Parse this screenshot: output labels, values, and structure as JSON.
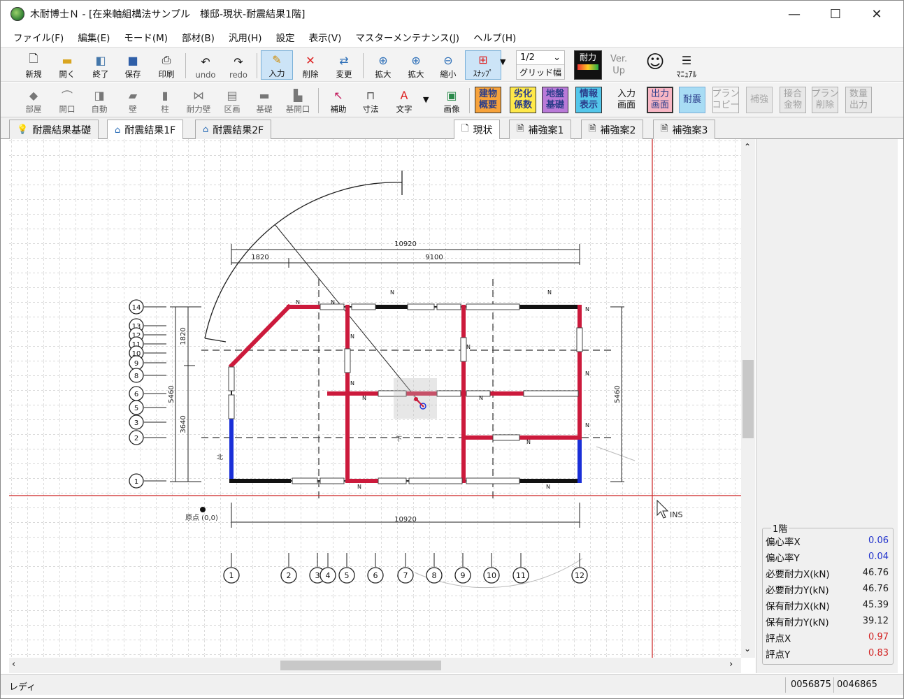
{
  "window": {
    "title": "木耐博士Ｎ - [在来軸組構法サンプル　様邸-現状-耐震結果1階]",
    "minimize": "—",
    "maximize": "☐",
    "close": "✕"
  },
  "menu": [
    "ファイル(F)",
    "編集(E)",
    "モード(M)",
    "部材(B)",
    "汎用(H)",
    "設定",
    "表示(V)",
    "マスターメンテナンス(J)",
    "ヘルプ(H)"
  ],
  "toolbar1": {
    "new": "新規",
    "open": "開く",
    "exit": "終了",
    "save": "保存",
    "print": "印刷",
    "undo": "undo",
    "redo": "redo",
    "input": "入力",
    "delete": "削除",
    "change": "変更",
    "zoom_in": "拡大",
    "zoom_in2": "拡大",
    "zoom_out": "縮小",
    "snap": "ｽﾅｯﾌﾟ",
    "grid_value": "1/2",
    "grid_label": "グリッド幅",
    "strength": "耐力",
    "ver_up_1": "Ver.",
    "ver_up_2": "Up",
    "manual": "ﾏﾆｭｱﾙ"
  },
  "toolbar2": {
    "room": "部屋",
    "opening": "開口",
    "auto": "自動",
    "wall": "壁",
    "pillar": "柱",
    "bearing_wall": "耐力壁",
    "zone": "区画",
    "foundation": "基礎",
    "foundation_opening": "基開口",
    "auxiliary": "補助",
    "dimension": "寸法",
    "text": "文字",
    "image": "画像",
    "building_overview": "建物\n概要",
    "deterioration": "劣化\n係数",
    "ground": "地盤\n基礎",
    "info": "情報\n表示",
    "input_screen": "入力\n画面",
    "output_screen": "出力\n画面",
    "seismic": "耐震",
    "plan_copy": "プラン\nコピー",
    "reinforce": "補強",
    "joint_hardware": "接合\n金物",
    "plan_delete": "プラン\n削除",
    "quantity_output": "数量\n出力"
  },
  "tabs_left": [
    {
      "label": "耐震結果基礎",
      "selected": false
    },
    {
      "label": "耐震結果1F",
      "selected": true
    },
    {
      "label": "耐震結果2F",
      "selected": false
    }
  ],
  "tabs_right": [
    {
      "label": "現状",
      "selected": true
    },
    {
      "label": "補強案1",
      "selected": false
    },
    {
      "label": "補強案2",
      "selected": false
    },
    {
      "label": "補強案3",
      "selected": false
    }
  ],
  "drawing": {
    "dim_total_top": "10920",
    "dim_left_seg": "1820",
    "dim_right_seg": "9100",
    "dim_total_bottom": "10920",
    "dim_vertical_total_left": "5460",
    "dim_vertical_top_left": "1820",
    "dim_vertical_bottom_left": "3640",
    "dim_vertical_total_right": "5460",
    "origin_label": "原点 (0,0)",
    "cursor_label": "INS",
    "x_axis_labels": [
      "1",
      "2",
      "3",
      "4",
      "5",
      "6",
      "7",
      "8",
      "9",
      "10",
      "11",
      "12"
    ],
    "y_axis_labels": [
      "14",
      "13",
      "12",
      "11",
      "10",
      "9",
      "8",
      "6",
      "5",
      "3",
      "2",
      "1"
    ],
    "labels": {
      "lower": "下",
      "dir": "北"
    }
  },
  "results": {
    "title": "1階",
    "rows": [
      {
        "label": "偏心率X",
        "value": "0.06",
        "color": "#2233cc"
      },
      {
        "label": "偏心率Y",
        "value": "0.04",
        "color": "#2233cc"
      },
      {
        "label": "必要耐力X(kN)",
        "value": "46.76",
        "color": "#222222"
      },
      {
        "label": "必要耐力Y(kN)",
        "value": "46.76",
        "color": "#222222"
      },
      {
        "label": "保有耐力X(kN)",
        "value": "45.39",
        "color": "#222222"
      },
      {
        "label": "保有耐力Y(kN)",
        "value": "39.12",
        "color": "#222222"
      },
      {
        "label": "評点X",
        "value": "0.97",
        "color": "#d22222"
      },
      {
        "label": "評点Y",
        "value": "0.83",
        "color": "#d22222"
      }
    ]
  },
  "status": {
    "left": "レディ",
    "coord_x": "0056875",
    "coord_y": "0046865"
  },
  "colors": {
    "wall_red": "#cc1a3c",
    "wall_blue": "#1a2fd8",
    "cursor_line": "#cc2222",
    "grid": "#9a9a9a"
  }
}
